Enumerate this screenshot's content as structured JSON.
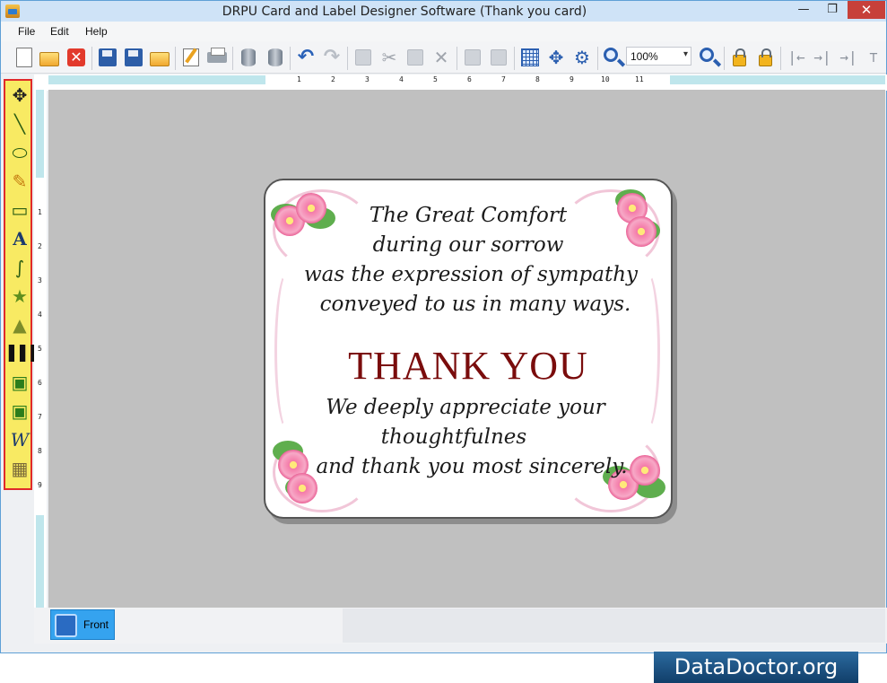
{
  "window": {
    "title": "DRPU Card and Label Designer Software  (Thank you card)",
    "minimize": "—",
    "maximize": "❐",
    "close": "✕"
  },
  "menu": [
    "File",
    "Edit",
    "Help"
  ],
  "toolbar": {
    "zoom_value": "100%"
  },
  "ruler": {
    "top_numbers": [
      "1",
      "2",
      "3",
      "4",
      "5",
      "6",
      "7",
      "8",
      "9",
      "10",
      "11"
    ],
    "left_numbers": [
      "1",
      "2",
      "3",
      "4",
      "5",
      "6",
      "7",
      "8",
      "9"
    ]
  },
  "card": {
    "lines_top": [
      "The Great Comfort",
      "during our sorrow",
      "was the expression of sympathy",
      "conveyed to us in many ways."
    ],
    "headline": "THANK YOU",
    "lines_bottom": [
      "We deeply appreciate your",
      "thoughtfulnes",
      "and thank you most sincerely."
    ],
    "headline_color": "#7a0c0c"
  },
  "tabs": [
    "Front"
  ],
  "watermark": "DataDoctor.org"
}
